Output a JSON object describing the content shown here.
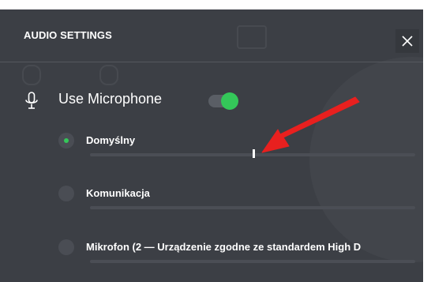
{
  "dialog": {
    "title": "AUDIO SETTINGS",
    "close_icon": "close-icon"
  },
  "microphone": {
    "icon": "microphone-icon",
    "label": "Use Microphone",
    "enabled": true,
    "accent_color": "#34c759"
  },
  "devices": [
    {
      "label": "Domyślny",
      "selected": true,
      "input_level": 0.5
    },
    {
      "label": "Komunikacja",
      "selected": false
    },
    {
      "label": "Mikrofon (2 — Urządzenie zgodne ze standardem High D",
      "selected": false
    }
  ],
  "annotation": {
    "icon": "red-arrow-icon",
    "color": "#e8201f"
  },
  "colors": {
    "panel_background": "#3c3f45",
    "text": "#ffffff"
  }
}
